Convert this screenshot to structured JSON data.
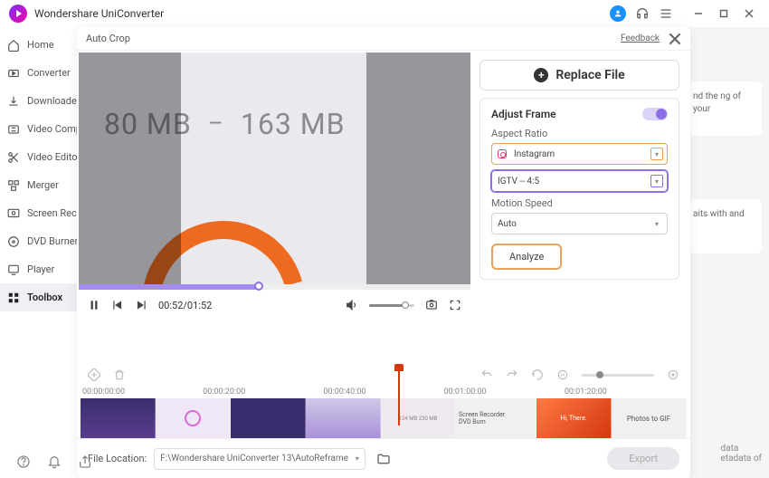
{
  "app": {
    "title": "Wondershare UniConverter"
  },
  "sidebar": {
    "items": [
      {
        "label": "Home"
      },
      {
        "label": "Converter"
      },
      {
        "label": "Downloader"
      },
      {
        "label": "Video Compressor"
      },
      {
        "label": "Video Editor"
      },
      {
        "label": "Merger"
      },
      {
        "label": "Screen Recorder"
      },
      {
        "label": "DVD Burner"
      },
      {
        "label": "Player"
      },
      {
        "label": "Toolbox"
      }
    ]
  },
  "panel": {
    "title": "Auto Crop",
    "feedback": "Feedback",
    "replace": "Replace File",
    "adjust_frame": "Adjust Frame",
    "aspect_ratio_label": "Aspect Ratio",
    "aspect_platform": "Instagram",
    "aspect_preset": "IGTV -- 4:5",
    "motion_label": "Motion Speed",
    "motion_value": "Auto",
    "analyze": "Analyze",
    "video_text": {
      "a": "80 MB",
      "dash": "–",
      "b": "163 MB"
    },
    "time": "00:52/01:52",
    "file_location_label": "File Location:",
    "file_location": "F:\\Wondershare UniConverter 13\\AutoReframe",
    "export": "Export"
  },
  "timeline": {
    "labels": [
      "00:00:00:00",
      "00:00:20:00",
      "00:00:40:00",
      "00:01:00:00",
      "00:01:20:00"
    ],
    "thumbs": {
      "t5a": "124 MB",
      "t5b": "230 MB",
      "t6a": "Screen Recorder",
      "t6b": "DVD Burn",
      "t7": "Hi, There.",
      "t8": "Photos to GIF"
    }
  },
  "bg": {
    "c1": "nd the ng of your",
    "c2": "aits with and",
    "c3": "data",
    "c3b": "etadata of"
  }
}
